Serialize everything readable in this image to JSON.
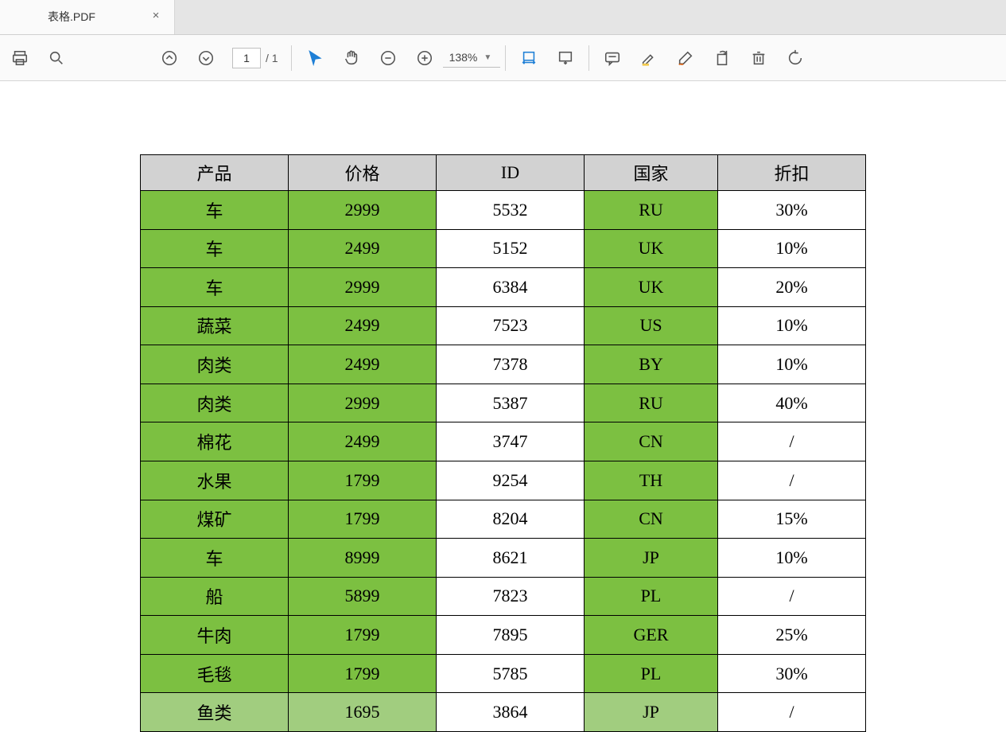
{
  "tab": {
    "title": "表格.PDF"
  },
  "toolbar": {
    "page_current": "1",
    "page_total": "/ 1",
    "zoom_value": "138%"
  },
  "table": {
    "headers": [
      "产品",
      "价格",
      "ID",
      "国家",
      "折扣"
    ],
    "rows": [
      {
        "product": "车",
        "price": "2999",
        "id": "5532",
        "country": "RU",
        "discount": "30%",
        "selected": false
      },
      {
        "product": "车",
        "price": "2499",
        "id": "5152",
        "country": "UK",
        "discount": "10%",
        "selected": false
      },
      {
        "product": "车",
        "price": "2999",
        "id": "6384",
        "country": "UK",
        "discount": "20%",
        "selected": false
      },
      {
        "product": "蔬菜",
        "price": "2499",
        "id": "7523",
        "country": "US",
        "discount": "10%",
        "selected": false
      },
      {
        "product": "肉类",
        "price": "2499",
        "id": "7378",
        "country": "BY",
        "discount": "10%",
        "selected": false
      },
      {
        "product": "肉类",
        "price": "2999",
        "id": "5387",
        "country": "RU",
        "discount": "40%",
        "selected": false
      },
      {
        "product": "棉花",
        "price": "2499",
        "id": "3747",
        "country": "CN",
        "discount": "/",
        "selected": false
      },
      {
        "product": "水果",
        "price": "1799",
        "id": "9254",
        "country": "TH",
        "discount": "/",
        "selected": false
      },
      {
        "product": "煤矿",
        "price": "1799",
        "id": "8204",
        "country": "CN",
        "discount": "15%",
        "selected": false
      },
      {
        "product": "车",
        "price": "8999",
        "id": "8621",
        "country": "JP",
        "discount": "10%",
        "selected": false
      },
      {
        "product": "船",
        "price": "5899",
        "id": "7823",
        "country": "PL",
        "discount": "/",
        "selected": false
      },
      {
        "product": "牛肉",
        "price": "1799",
        "id": "7895",
        "country": "GER",
        "discount": "25%",
        "selected": false
      },
      {
        "product": "毛毯",
        "price": "1799",
        "id": "5785",
        "country": "PL",
        "discount": "30%",
        "selected": false
      },
      {
        "product": "鱼类",
        "price": "1695",
        "id": "3864",
        "country": "JP",
        "discount": "/",
        "selected": true
      }
    ]
  }
}
